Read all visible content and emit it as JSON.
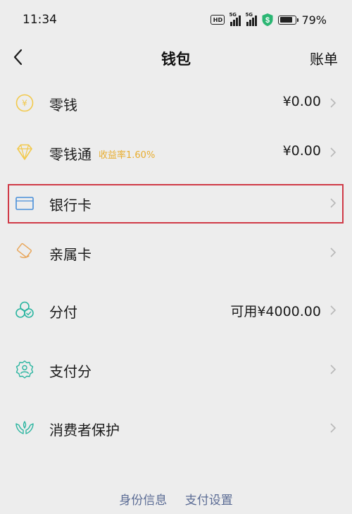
{
  "status_bar": {
    "time": "11:34",
    "hd": "HD",
    "net1": "5G",
    "net2": "5G",
    "battery_pct": "79%",
    "battery_level": 0.79,
    "shield_color": "#2bb673",
    "shield_glyph": "$"
  },
  "header": {
    "title": "钱包",
    "bill_label": "账单"
  },
  "items": [
    {
      "label": "零钱",
      "value": "¥0.00",
      "icon": "coin-yen-icon"
    },
    {
      "label": "零钱通",
      "tag": "收益率1.60%",
      "value": "¥0.00",
      "icon": "diamond-icon"
    },
    {
      "label": "银行卡",
      "value": "",
      "icon": "bank-card-icon"
    },
    {
      "label": "亲属卡",
      "value": "",
      "icon": "family-card-icon"
    },
    {
      "label": "分付",
      "value": "可用¥4000.00",
      "icon": "installment-icon"
    },
    {
      "label": "支付分",
      "value": "",
      "icon": "pay-score-icon"
    },
    {
      "label": "消费者保护",
      "value": "",
      "icon": "consumer-protection-icon"
    }
  ],
  "footer": {
    "identity_label": "身份信息",
    "settings_label": "支付设置"
  },
  "colors": {
    "background": "#ededed",
    "yellow_icon": "#f2c94c",
    "blue_icon": "#4a90d9",
    "orange_icon": "#e8a65a",
    "teal_icon": "#2bb5a0",
    "highlight": "#d03a47",
    "footer_link": "#5a6b94"
  }
}
